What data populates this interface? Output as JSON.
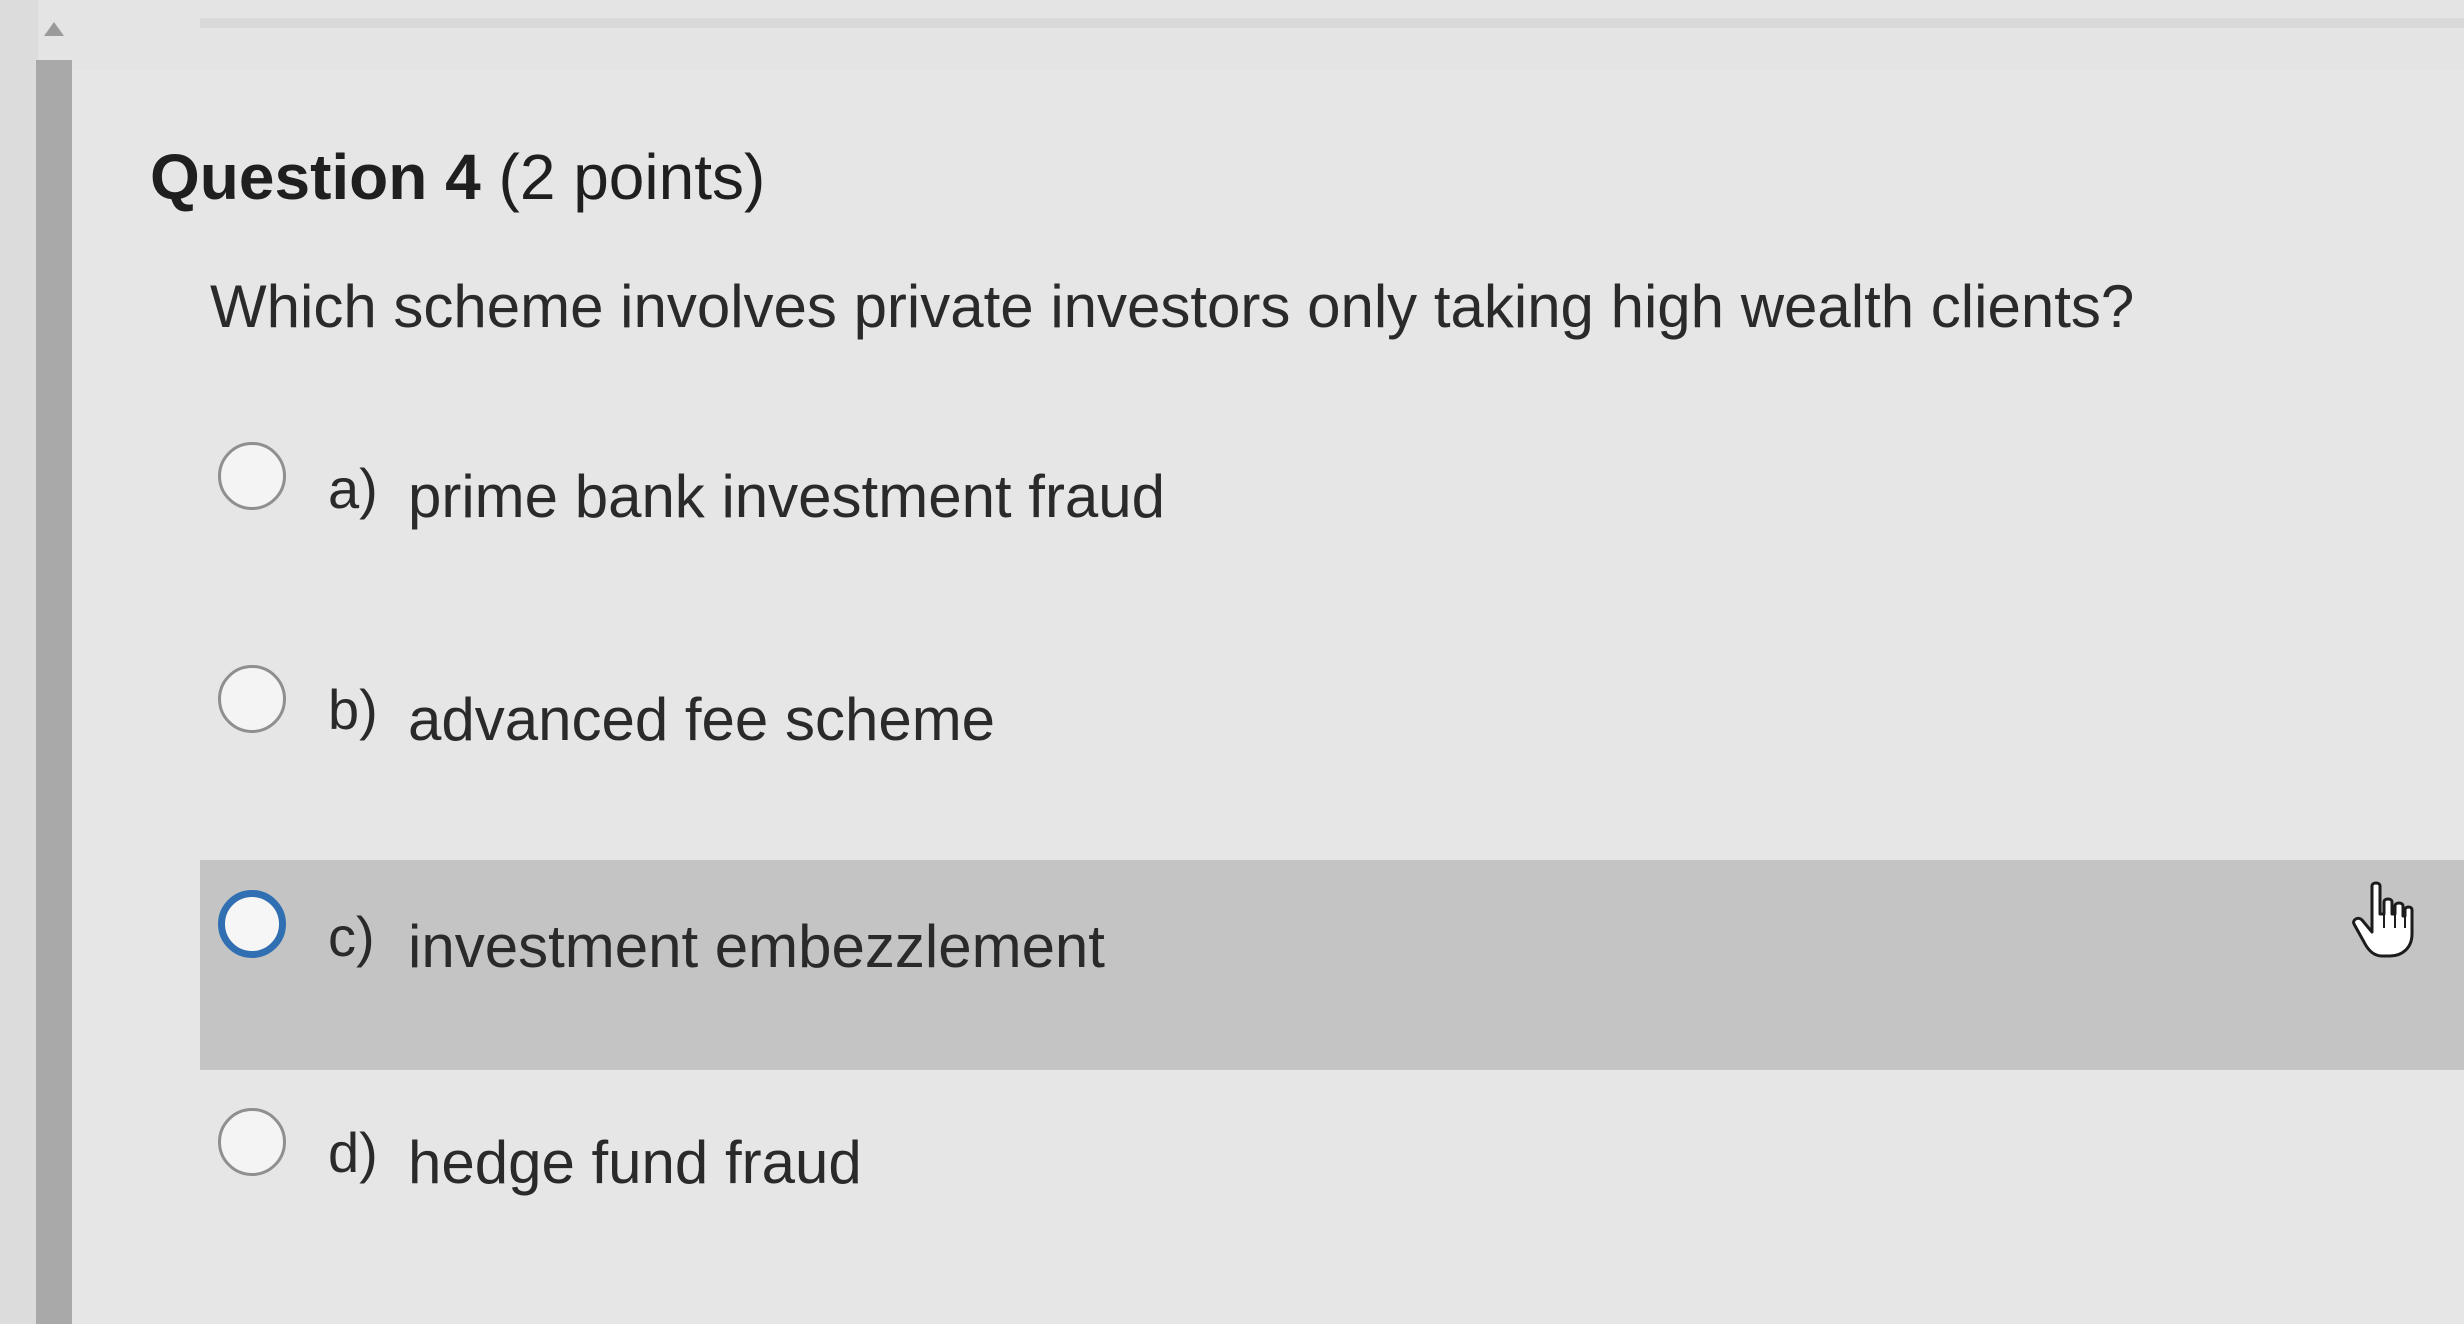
{
  "question": {
    "name": "Question 4",
    "points": "(2 points)",
    "text": "Which scheme involves private investors only taking high wealth clients?"
  },
  "options": [
    {
      "letter": "a)",
      "label": "prime bank investment fraud",
      "state": "default"
    },
    {
      "letter": "b)",
      "label": "advanced fee scheme",
      "state": "default"
    },
    {
      "letter": "c)",
      "label": "investment embezzlement",
      "state": "hovered"
    },
    {
      "letter": "d)",
      "label": "hedge fund fraud",
      "state": "default"
    }
  ],
  "colors": {
    "background": "#e6e6e6",
    "hover_row": "#c4c4c4",
    "focus_ring": "#2f6fb2",
    "scrollbar_thumb": "#a9a9a9"
  },
  "icons": {
    "cursor": "hand-pointer-icon",
    "scroll_up": "scroll-up-arrow-icon"
  }
}
